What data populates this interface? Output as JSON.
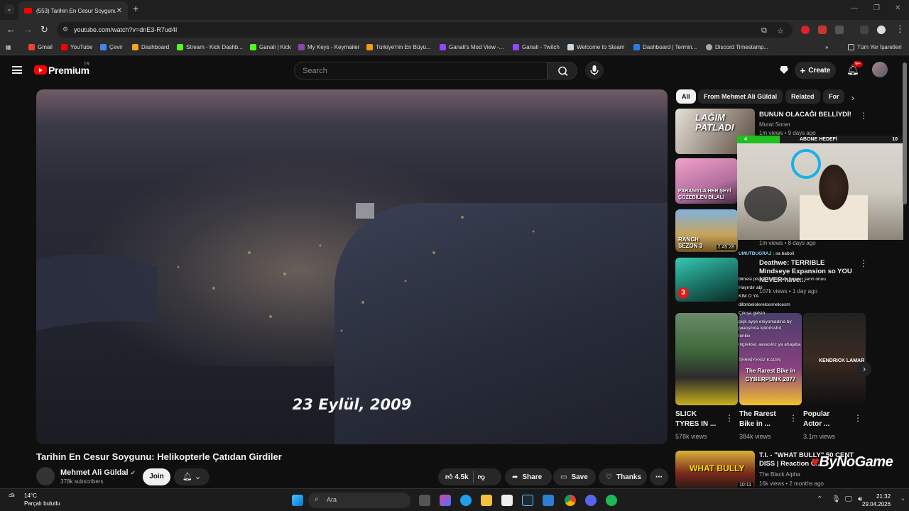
{
  "browser": {
    "tab_title": "(553) Tarihin En Cesur Soygunu",
    "new_tab": "+",
    "url": "youtube.com/watch?v=dnE3-R7ud4I",
    "bookmarks": [
      {
        "label": "Gmail",
        "color": "#ea4335"
      },
      {
        "label": "YouTube",
        "color": "#ff0000"
      },
      {
        "label": "Çevir",
        "color": "#4285f4"
      },
      {
        "label": "Dashboard",
        "color": "#f5a623"
      },
      {
        "label": "Stream - Kick Dashb...",
        "color": "#53fc18"
      },
      {
        "label": "Ganali | Kick",
        "color": "#53fc18"
      },
      {
        "label": "My Keys - Keymailer",
        "color": "#8e44ad"
      },
      {
        "label": "Türkiye'nin En Büyü...",
        "color": "#f39c12"
      },
      {
        "label": "Ganali's Mod View -...",
        "color": "#9146ff"
      },
      {
        "label": "Ganali - Twitch",
        "color": "#9146ff"
      },
      {
        "label": "Welcome to Steam",
        "color": "#c7d5e0"
      },
      {
        "label": "Dashboard | Termin...",
        "color": "#2c7be5"
      },
      {
        "label": "Discord Timestamp...",
        "color": "#aaaaaa"
      }
    ],
    "all_bookmarks": "Tüm Yer İşaretleri"
  },
  "youtube": {
    "logo_text": "Premium",
    "region": "TR",
    "search_placeholder": "Search",
    "create_label": "Create",
    "notif_count": "9+"
  },
  "video": {
    "caption": "23 Eylül, 2009",
    "title": "Tarihin En Cesur Soygunu: Helikopterle Çatıdan Girdiler",
    "channel": "Mehmet Ali Güldal",
    "subscribers": "378k subscribers",
    "join": "Join",
    "likes": "4.5k",
    "share": "Share",
    "save": "Save",
    "thanks": "Thanks"
  },
  "chips": [
    "All",
    "From Mehmet Ali Güldal",
    "Related",
    "For"
  ],
  "recommendations": [
    {
      "title": "BUNUN OLACAĞI BELLİYDİ!",
      "channel": "Murat Soner",
      "meta": "1m views • 9 days ago",
      "thumb_text": "LAĞIM PATLADI"
    },
    {
      "thumb_text": "PARASIYLA HER ŞEYİ ÇÖZEBİLEN BİLALİ"
    },
    {
      "thumb_text": "RANCH SEZON 3",
      "duration": "2:45:28",
      "meta": "1m views • 8 days ago"
    },
    {
      "title": "Deathwe: TERRIBLE Mindseye Expansion so YOU NEVER have...",
      "meta": "107k views • 1 day ago",
      "thumb_text": "3"
    }
  ],
  "shorts": [
    {
      "title": "SLICK TYRES IN ...",
      "views": "578k views"
    },
    {
      "title": "The Rarest Bike in ...",
      "views": "384k views",
      "thumb_text": "The Rarest Bike in CYBERPUNK 2077"
    },
    {
      "title": "Popular Actor ...",
      "views": "3.1m views",
      "thumb_text": "KENDRICK LAMAR"
    }
  ],
  "bottom_rec": {
    "title": "T.I. - \"WHAT BULLY\" 50 CENT DISS | Reaction C...",
    "channel": "The Black Alpha",
    "meta": "16k views • 2 months ago",
    "duration": "10:11",
    "thumb_text": "WHAT BULLY"
  },
  "overlay": {
    "goal_label": "ABONE HEDEFİ",
    "goal_current": "4",
    "goal_target": "10",
    "watermark": "ByNoGame",
    "chat": [
      {
        "user": "UMUTBUGRAJ :",
        "msg": "sa baboli"
      },
      {
        "user": "",
        "msg": "bimesi pis kadınımış abi boşver senn onuu"
      },
      {
        "user": "",
        "msg": "Hayırdır abi"
      },
      {
        "user": "",
        "msg": "KIM O YA"
      },
      {
        "user": "",
        "msg": "dilbnbelolerelcesnelcesm"
      },
      {
        "user": "",
        "msg": "Çıkışa gelsin"
      },
      {
        "user": "",
        "msg": "pişk ayşe eniyomadına by"
      },
      {
        "user": "",
        "msg": "jwalışmda kplodsshd"
      },
      {
        "user": "",
        "msg": "lenkix"
      },
      {
        "user": "",
        "msg": "ingrekse: aavasiriz ya ahajaba"
      },
      {
        "user": "",
        "msg": "TERBİYESİZ KADIN"
      }
    ]
  },
  "taskbar": {
    "temp": "14°C",
    "weather": "Parçalı bulutlu",
    "search": "Ara",
    "time": "21:32",
    "date": "29.04.2026"
  }
}
